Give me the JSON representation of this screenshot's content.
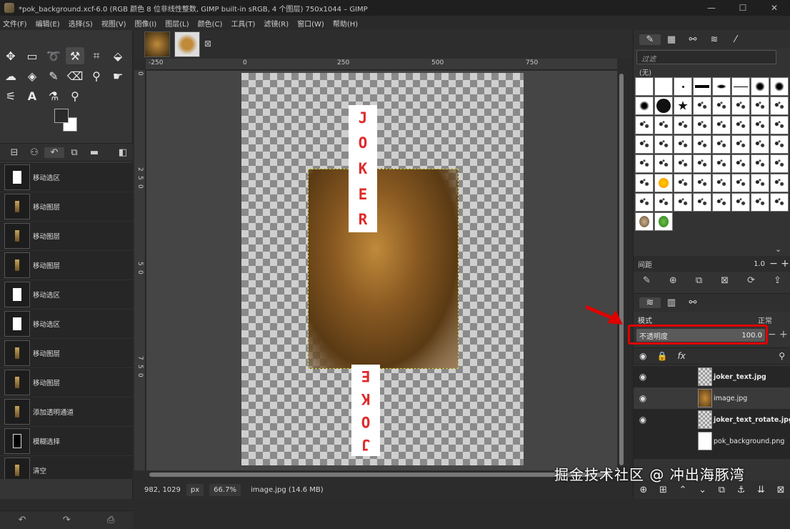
{
  "window": {
    "title": "*pok_background.xcf-6.0 (RGB 颜色 8 位非线性整数, GIMP built-in sRGB, 4 个图层) 750x1044 – GIMP",
    "controls": [
      "—",
      "☐",
      "✕"
    ]
  },
  "menu": [
    "文件(F)",
    "编辑(E)",
    "选择(S)",
    "视图(V)",
    "图像(I)",
    "图层(L)",
    "颜色(C)",
    "工具(T)",
    "滤镜(R)",
    "窗口(W)",
    "帮助(H)"
  ],
  "history": {
    "items": [
      {
        "label": "移动选区",
        "thumb": "white"
      },
      {
        "label": "移动图层",
        "thumb": "lion"
      },
      {
        "label": "移动图层",
        "thumb": "lion"
      },
      {
        "label": "移动图层",
        "thumb": "lion"
      },
      {
        "label": "移动选区",
        "thumb": "white"
      },
      {
        "label": "移动选区",
        "thumb": "white"
      },
      {
        "label": "移动图层",
        "thumb": "lion"
      },
      {
        "label": "移动图层",
        "thumb": "lion"
      },
      {
        "label": "添加透明通道",
        "thumb": "lion"
      },
      {
        "label": "模糊选择",
        "thumb": "black"
      },
      {
        "label": "清空",
        "thumb": "lion"
      }
    ]
  },
  "ruler": {
    "top": [
      "-250",
      "0",
      "250",
      "500",
      "750"
    ],
    "left": [
      "0",
      "2",
      "5",
      "0",
      "5",
      "0",
      "7",
      "5",
      "0"
    ]
  },
  "canvas": {
    "card_text": [
      "J",
      "O",
      "K",
      "E",
      "R"
    ]
  },
  "status": {
    "coords": "982, 1029",
    "unit": "px",
    "zoom": "66.7%",
    "info": "image.jpg (14.6 MB)"
  },
  "brushes": {
    "filter_placeholder": "过滤",
    "none_label": "(无)",
    "spacing_label": "间距",
    "spacing_value": "1.0"
  },
  "layers_panel": {
    "mode_label": "模式",
    "mode_value": "正常",
    "opacity_label": "不透明度",
    "opacity_value": "100.0",
    "layers": [
      {
        "name": "joker_text.jpg",
        "bold": true,
        "thumb": "checker"
      },
      {
        "name": "image.jpg",
        "bold": false,
        "thumb": "lion"
      },
      {
        "name": "joker_text_rotate.jpg",
        "bold": true,
        "thumb": "checker"
      },
      {
        "name": "pok_background.png",
        "bold": false,
        "thumb": "white"
      }
    ]
  },
  "watermark": "掘金技术社区 @ 冲出海豚湾",
  "colors": {
    "highlight": "#e00000",
    "card_text": "#e02a2a"
  }
}
